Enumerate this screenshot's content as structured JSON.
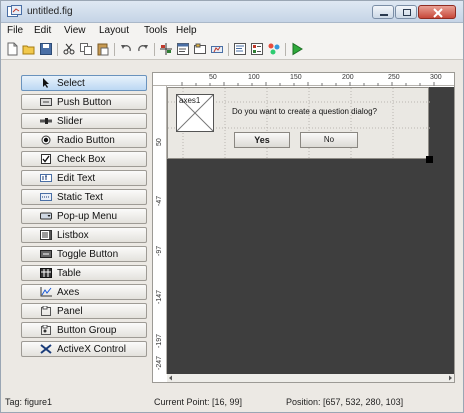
{
  "window": {
    "title": "untitled.fig"
  },
  "menu": [
    "File",
    "Edit",
    "View",
    "Layout",
    "Tools",
    "Help"
  ],
  "toolbar_icons": [
    "new-file-icon",
    "open-folder-icon",
    "save-icon",
    "cut-icon",
    "copy-icon",
    "paste-icon",
    "undo-icon",
    "redo-icon",
    "align-icon",
    "menu-editor-icon",
    "tab-order-icon",
    "toolbar-editor-icon",
    "code-editor-icon",
    "property-inspector-icon",
    "object-browser-icon",
    "run-icon"
  ],
  "palette": [
    {
      "label": "Select",
      "icon": "cursor-arrow-icon"
    },
    {
      "label": "Push Button",
      "icon": "push-button-icon"
    },
    {
      "label": "Slider",
      "icon": "slider-icon"
    },
    {
      "label": "Radio Button",
      "icon": "radio-button-icon"
    },
    {
      "label": "Check Box",
      "icon": "check-box-icon"
    },
    {
      "label": "Edit Text",
      "icon": "edit-text-icon"
    },
    {
      "label": "Static Text",
      "icon": "static-text-icon"
    },
    {
      "label": "Pop-up Menu",
      "icon": "popup-menu-icon"
    },
    {
      "label": "Listbox",
      "icon": "listbox-icon"
    },
    {
      "label": "Toggle Button",
      "icon": "toggle-button-icon"
    },
    {
      "label": "Table",
      "icon": "table-icon"
    },
    {
      "label": "Axes",
      "icon": "axes-icon"
    },
    {
      "label": "Panel",
      "icon": "panel-icon"
    },
    {
      "label": "Button Group",
      "icon": "button-group-icon"
    },
    {
      "label": "ActiveX Control",
      "icon": "activex-icon"
    }
  ],
  "ruler": {
    "top": [
      "50",
      "100",
      "150",
      "200",
      "250",
      "300"
    ],
    "left": [
      "50",
      "-47",
      "-97",
      "-147",
      "-197",
      "-247"
    ]
  },
  "figure": {
    "axes_label": "axes1",
    "question": "Do you want to create a question dialog?",
    "yes_label": "Yes",
    "no_label": "No"
  },
  "status": {
    "tag": "Tag: figure1",
    "current_point": "Current Point:  [16, 99]",
    "position": "Position: [657, 532, 280, 103]"
  }
}
